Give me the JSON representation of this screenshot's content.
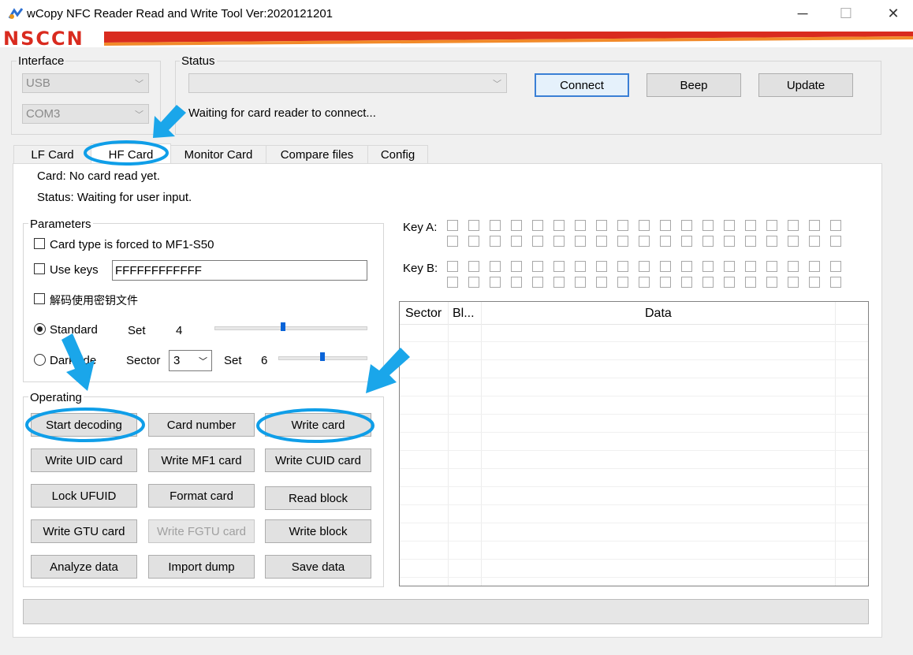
{
  "window": {
    "title": "wCopy NFC Reader Read and Write Tool  Ver:2020121201",
    "minimize": "─",
    "maximize": "☐",
    "close": "✕",
    "logo": "NSCCN"
  },
  "interface": {
    "label": "Interface",
    "type": "USB",
    "port": "COM3"
  },
  "status": {
    "label": "Status",
    "device": "",
    "message": "Waiting for card reader to connect...",
    "connect": "Connect",
    "beep": "Beep",
    "update": "Update"
  },
  "tabs": [
    "LF Card",
    "HF Card",
    "Monitor Card",
    "Compare files",
    "Config"
  ],
  "active_tab": "HF Card",
  "card_info": {
    "card": "Card: No card read yet.",
    "status": "Status: Waiting for user input."
  },
  "parameters": {
    "label": "Parameters",
    "forced": "Card type is forced to MF1-S50",
    "use_keys": "Use keys",
    "keys_value": "FFFFFFFFFFFF",
    "decode_file": "解码使用密钥文件",
    "standard": "Standard",
    "set_label": "Set",
    "set1_value": "4",
    "set1_level": 0.45,
    "darkside": "Darkside",
    "sector_label": "Sector",
    "sector_value": "3",
    "set2_value": "6",
    "set2_level": 0.5
  },
  "operating": {
    "label": "Operating",
    "buttons": [
      "Start decoding",
      "Card number",
      "Write card",
      "Write UID card",
      "Write MF1 card",
      "Write CUID card",
      "Lock UFUID",
      "Format card",
      "Read block",
      "Write GTU card",
      "Write FGTU card",
      "Write block",
      "Analyze data",
      "Import dump",
      "Save data"
    ]
  },
  "keys": {
    "a_label": "Key A:",
    "b_label": "Key B:"
  },
  "table": {
    "columns": [
      "Sector",
      "Bl...",
      "Data"
    ]
  },
  "colors": {
    "annotation": "#1aa6ea",
    "focus_border": "#3a7fd5",
    "logo_red": "#d92b1f"
  }
}
